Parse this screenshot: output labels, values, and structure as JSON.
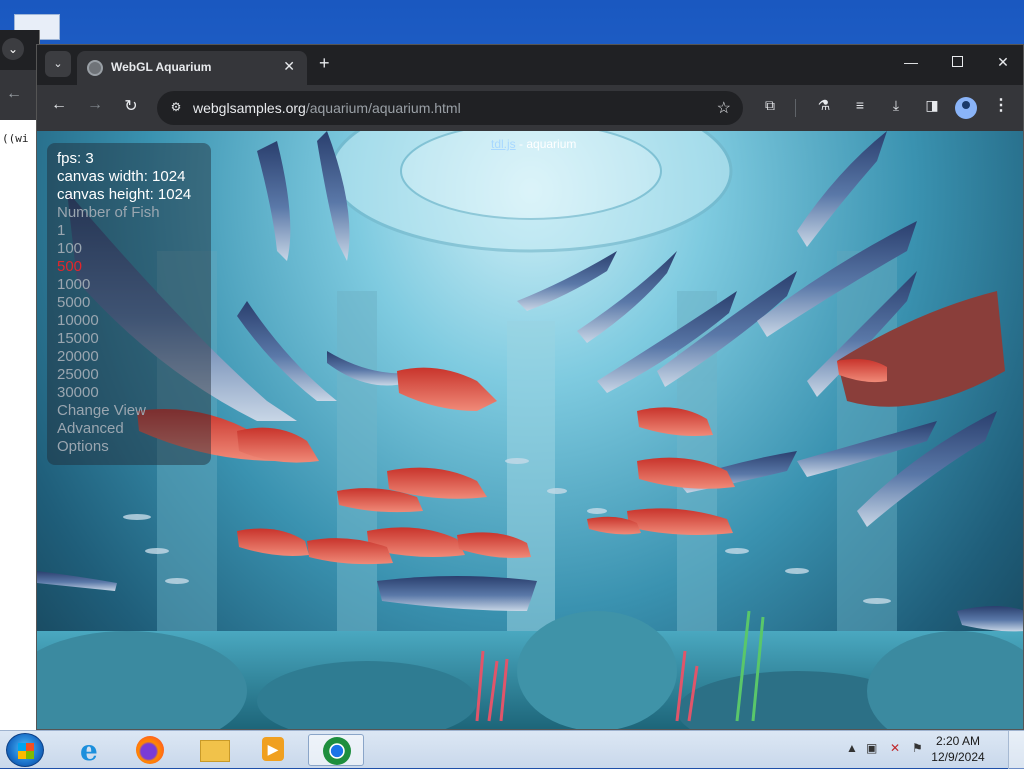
{
  "browser": {
    "tab_title": "WebGL Aquarium",
    "tab_close": "✕",
    "new_tab": "+",
    "url_host": "webglsamples.org",
    "url_path": "/aquarium/aquarium.html"
  },
  "background_window": {
    "text": "((wi"
  },
  "page": {
    "heading_link": "tdl.js",
    "heading_text": " - aquarium"
  },
  "hud": {
    "fps": "fps: 3",
    "canvas_width": "canvas width: 1024",
    "canvas_height": "canvas height: 1024",
    "section_label": "Number of Fish",
    "fish_options": [
      "1",
      "100",
      "500",
      "1000",
      "5000",
      "10000",
      "15000",
      "20000",
      "25000",
      "30000"
    ],
    "selected_fish_option": "500",
    "change_view": "Change View",
    "advanced": "Advanced",
    "options": "Options"
  },
  "taskbar": {
    "time": "2:20 AM",
    "date": "12/9/2024"
  },
  "colors": {
    "selected_option": "#e2262b",
    "chrome_dark": "#202124",
    "toolbar": "#35363a"
  },
  "icons": [
    "search-tabs-icon",
    "favicon-icon",
    "close-icon",
    "plus-icon",
    "minimize-icon",
    "maximize-icon",
    "back-icon",
    "forward-icon",
    "reload-icon",
    "site-info-icon",
    "star-icon",
    "extensions-icon",
    "labs-icon",
    "media-queue-icon",
    "download-icon",
    "side-panel-icon",
    "profile-icon",
    "menu-icon",
    "windows-start-icon",
    "internet-explorer-icon",
    "firefox-icon",
    "file-explorer-icon",
    "media-player-icon",
    "chrome-icon",
    "network-icon",
    "volume-muted-icon",
    "flag-icon"
  ]
}
